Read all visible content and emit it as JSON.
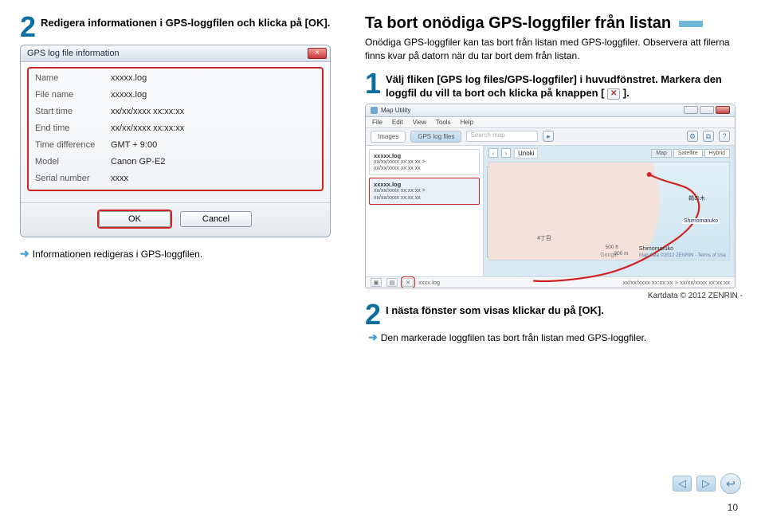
{
  "left": {
    "step_num": "2",
    "step_text": "Redigera informationen i GPS-loggfilen och klicka på [OK].",
    "note_text": "Informationen redigeras i GPS-loggfilen."
  },
  "dialog": {
    "title": "GPS log file information",
    "close_label": "×",
    "fields": {
      "name_label": "Name",
      "name_val": "xxxxx.log",
      "filename_label": "File name",
      "filename_val": "xxxxx.log",
      "start_label": "Start time",
      "start_val": "xx/xx/xxxx xx:xx:xx",
      "end_label": "End time",
      "end_val": "xx/xx/xxxx xx:xx:xx",
      "tz_label": "Time difference",
      "tz_val": "GMT + 9:00",
      "model_label": "Model",
      "model_val": "Canon GP-E2",
      "serial_label": "Serial number",
      "serial_val": "xxxx"
    },
    "ok": "OK",
    "cancel": "Cancel"
  },
  "right": {
    "heading": "Ta bort onödiga GPS-loggfiler från listan",
    "intro": "Onödiga GPS-loggfiler kan tas bort från listan med GPS-loggfiler. Observera att filerna finns kvar på datorn när du tar bort dem från listan.",
    "step1_num": "1",
    "step1_text_a": "Välj fliken [GPS log files/GPS-loggfiler] i huvudfönstret. Markera den loggfil du vill ta bort och klicka på knappen [",
    "step1_text_b": "].",
    "credit": "Kartdata © 2012 ZENRIN -",
    "step2_num": "2",
    "step2_text": "I nästa fönster som visas klickar du på [OK].",
    "note2_text": "Den markerade loggfilen tas bort från listan med GPS-loggfiler."
  },
  "maputil": {
    "title": "Map Utility",
    "menu": {
      "file": "File",
      "edit": "Edit",
      "view": "View",
      "tools": "Tools",
      "help": "Help"
    },
    "tabs": {
      "images": "Images",
      "gps": "GPS log files"
    },
    "search_placeholder": "Search map",
    "loc1": "Unoki",
    "map": "Map",
    "satellite": "Satellite",
    "hybrid": "Hybrid",
    "log1": {
      "name": "xxxxx.log",
      "l1": "xx/xx/xxxx xx:xx:xx >",
      "l2": "xx/xx/xxxx xx:xx:xx"
    },
    "log2": {
      "name": "xxxxx.log",
      "l1": "xx/xx/xxxx xx:xx:xx >",
      "l2": "xx/xx/xxxx xx:xx:xx"
    },
    "place_shimo": "Shimomaruko",
    "place_shimo2": "Shimomaruko",
    "scale": "500 ft",
    "scale2": "200 m",
    "google": "Google",
    "attrib": "Map data ©2012 ZENRIN - Terms of Use",
    "status_left": "xxxx.log",
    "status_right": "xx/xx/xxxx xx:xx:xx > xx/xx/xxxx xx:xx:xx"
  },
  "page_number": "10"
}
